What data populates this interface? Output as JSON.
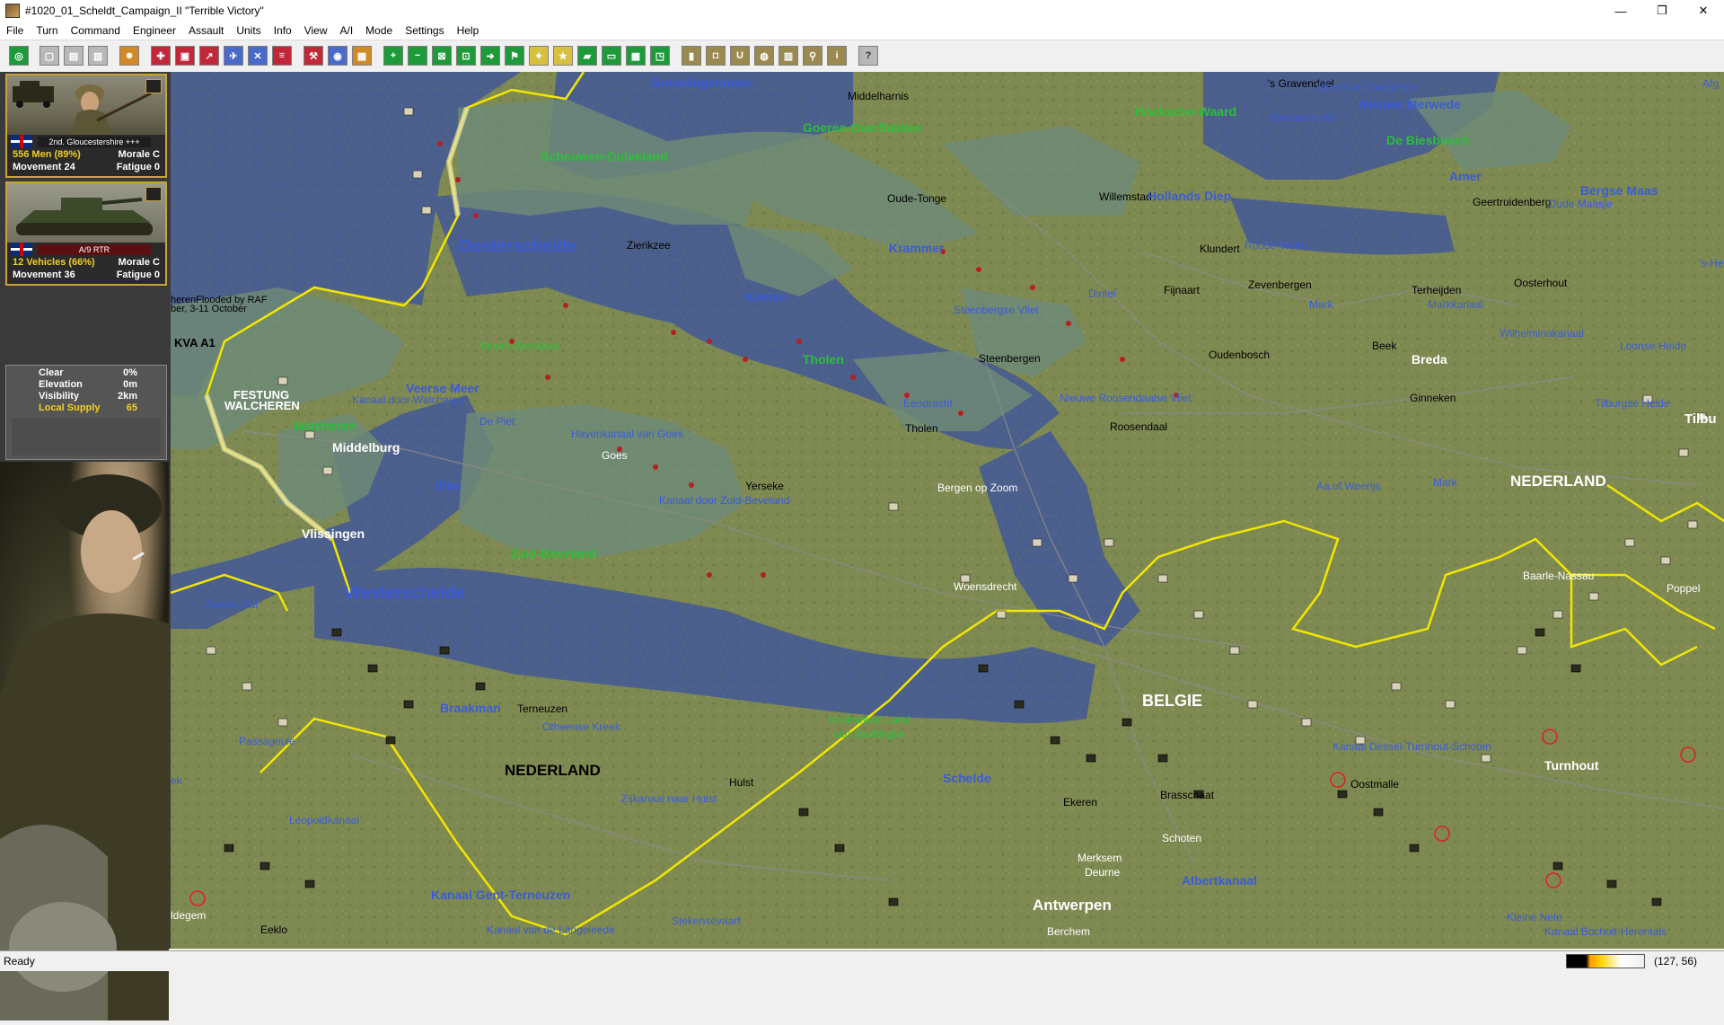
{
  "window": {
    "title": "#1020_01_Scheldt_Campaign_II \"Terrible Victory\"",
    "minimize": "—",
    "restore": "❐",
    "close": "✕"
  },
  "menu": [
    "File",
    "Turn",
    "Command",
    "Engineer",
    "Assault",
    "Units",
    "Info",
    "View",
    "A/I",
    "Mode",
    "Settings",
    "Help"
  ],
  "unit1": {
    "name": "2nd. Gloucestershire +++",
    "strength": "556 Men (89%)",
    "morale": "Morale C",
    "movement": "Movement 24",
    "fatigue": "Fatigue 0"
  },
  "unit2": {
    "name": "A/9 RTR",
    "strength": "12 Vehicles (66%)",
    "morale": "Morale C",
    "movement": "Movement 36",
    "fatigue": "Fatigue 0"
  },
  "terrain": {
    "weather_label": "Clear",
    "weather_value": "0%",
    "elevation_label": "Elevation",
    "elevation_value": "0m",
    "visibility_label": "Visibility",
    "visibility_value": "2km",
    "supply_label": "Local Supply",
    "supply_value": "65"
  },
  "map_labels": {
    "grevelingenmeer": "Grevelingenmeer",
    "middelharnis": "Middelharnis",
    "goeree": "Goeree-Overflakkee",
    "hoeksche": "Hoeksche-Waard",
    "gravendeel": "'s Gravendeel",
    "eiland_dordrecht": "Eiland van Dordrecht",
    "nieuwe_merwede": "Nieuwe Merwede",
    "dordtsche_kil": "Dordtsche Kil",
    "biesbosch": "De Biesbosch",
    "amer": "Amer",
    "bergse_maas": "Bergse Maas",
    "geertruidenberg": "Geertruidenberg",
    "oude_maasje": "Oude Maasje",
    "schouwen": "Schouwen-Duiveland",
    "oude_tonge": "Oude-Tonge",
    "willemstad": "Willemstad",
    "hollands_diep": "Hollands Diep",
    "oosterschelde": "Oosterschelde",
    "zierikzee": "Zierikzee",
    "krammer": "Krammer",
    "klundert": "Klundert",
    "roode_vaart": "Roode Vaart",
    "zevenbergen": "Zevenbergen",
    "terheijden": "Terheijden",
    "oosterhout": "Oosterhout",
    "keeten": "Keeten",
    "dintel": "Dintel",
    "fijnaart": "Fijnaart",
    "mark_n": "Mark",
    "markkanaal": "Markkanaal",
    "flooded": "herenFlooded by RAF",
    "flooded_date": "ber, 3-11 October",
    "steenbergse_vliet": "Steenbergse Vliet",
    "wilhelmina": "Wilhelminakanaal",
    "loonse": "Loonse Heide",
    "kva": "KVA A1",
    "noord_beveland": "Noord-Beveland",
    "tholen": "Tholen",
    "steenbergen": "Steenbergen",
    "oudenbosch": "Oudenbosch",
    "beek": "Beek",
    "breda": "Breda",
    "festung": "FESTUNG",
    "walcheren_f": "WALCHEREN",
    "veerse_meer": "Veerse Meer",
    "kanaal_walcheren": "Kanaal door Walcheren",
    "eendracht": "Eendracht",
    "nieuwe_roosendaalse": "Nieuwe Roosendaalse Vliet",
    "ginneken": "Ginneken",
    "tilburgse": "Tilburgse Heide",
    "tilbu": "Tilbu",
    "walcheren": "Walcheren",
    "de_piet": "De Piet",
    "tholen_town": "Tholen",
    "roosendaal": "Roosendaal",
    "middelburg": "Middelburg",
    "havenkanaal": "Havenkanaal van Goes",
    "goes": "Goes",
    "sloe": "Sloe",
    "yerseke": "Yerseke",
    "bergen_op_zoom": "Bergen op Zoom",
    "kanaal_zuid_beveland": "Kanaal door Zuid-Beveland",
    "aa_weerijs": "Aa of Weerijs",
    "mark_s": "Mark",
    "nederland_ne": "NEDERLAND",
    "vlissingen": "Vlissingen",
    "zuid_beveland": "Zuid-Beveland",
    "baarle": "Baarle-Nassau",
    "westerschelde": "Westerschelde",
    "woensdrecht": "Woensdrecht",
    "zwarte_gat": "Zwarte Gat",
    "poppel": "Poppel",
    "braakman": "Braakman",
    "terneuzen": "Terneuzen",
    "otheense": "Otheense Kreek",
    "verdronken": "Verdronken Land",
    "saeftinghe": "van Saeftinghe",
    "belgie": "BELGIE",
    "passageule": "Passageule",
    "nederland_s": "NEDERLAND",
    "kanaal_dessel": "Kanaal Dessel-Turnhout-Schoten",
    "turnhout": "Turnhout",
    "hulst": "Hulst",
    "zijkanaal": "Zijkanaal naar Hulst",
    "schelde": "Schelde",
    "oostmalle": "Oostmalle",
    "brasschaat": "Brasschaat",
    "leopoldkanaal": "Leopoldkanaal",
    "ekeren": "Ekeren",
    "schoten": "Schoten",
    "merksem": "Merksem",
    "borgerhout": "Deurne",
    "albertkanaal": "Albertkanaal",
    "ek": "ek",
    "gent_terneuzen": "Kanaal Gent-Terneuzen",
    "antwerpen": "Antwerpen",
    "idegem": "ldegem",
    "stekense": "Stekensevaart",
    "kleine_nete": "Kleine Nete",
    "eeklo": "Eeklo",
    "langeleede": "Kanaal van de Langeleede",
    "berchem": "Berchem",
    "bocholt": "Kanaal Bocholt-Herentals",
    "afg": "Afg",
    "s_he": "'s-He"
  },
  "status": {
    "text": "Ready",
    "coords": "(127, 56)"
  },
  "colors": {
    "water": "#4b5f8e",
    "land": "#7f8a52",
    "polder": "#6f8a78",
    "frontline": "#f2e600",
    "label_green": "#2bbf3a",
    "label_blue": "#3b5bd9",
    "label_white": "#ffffff",
    "label_black": "#000000"
  }
}
